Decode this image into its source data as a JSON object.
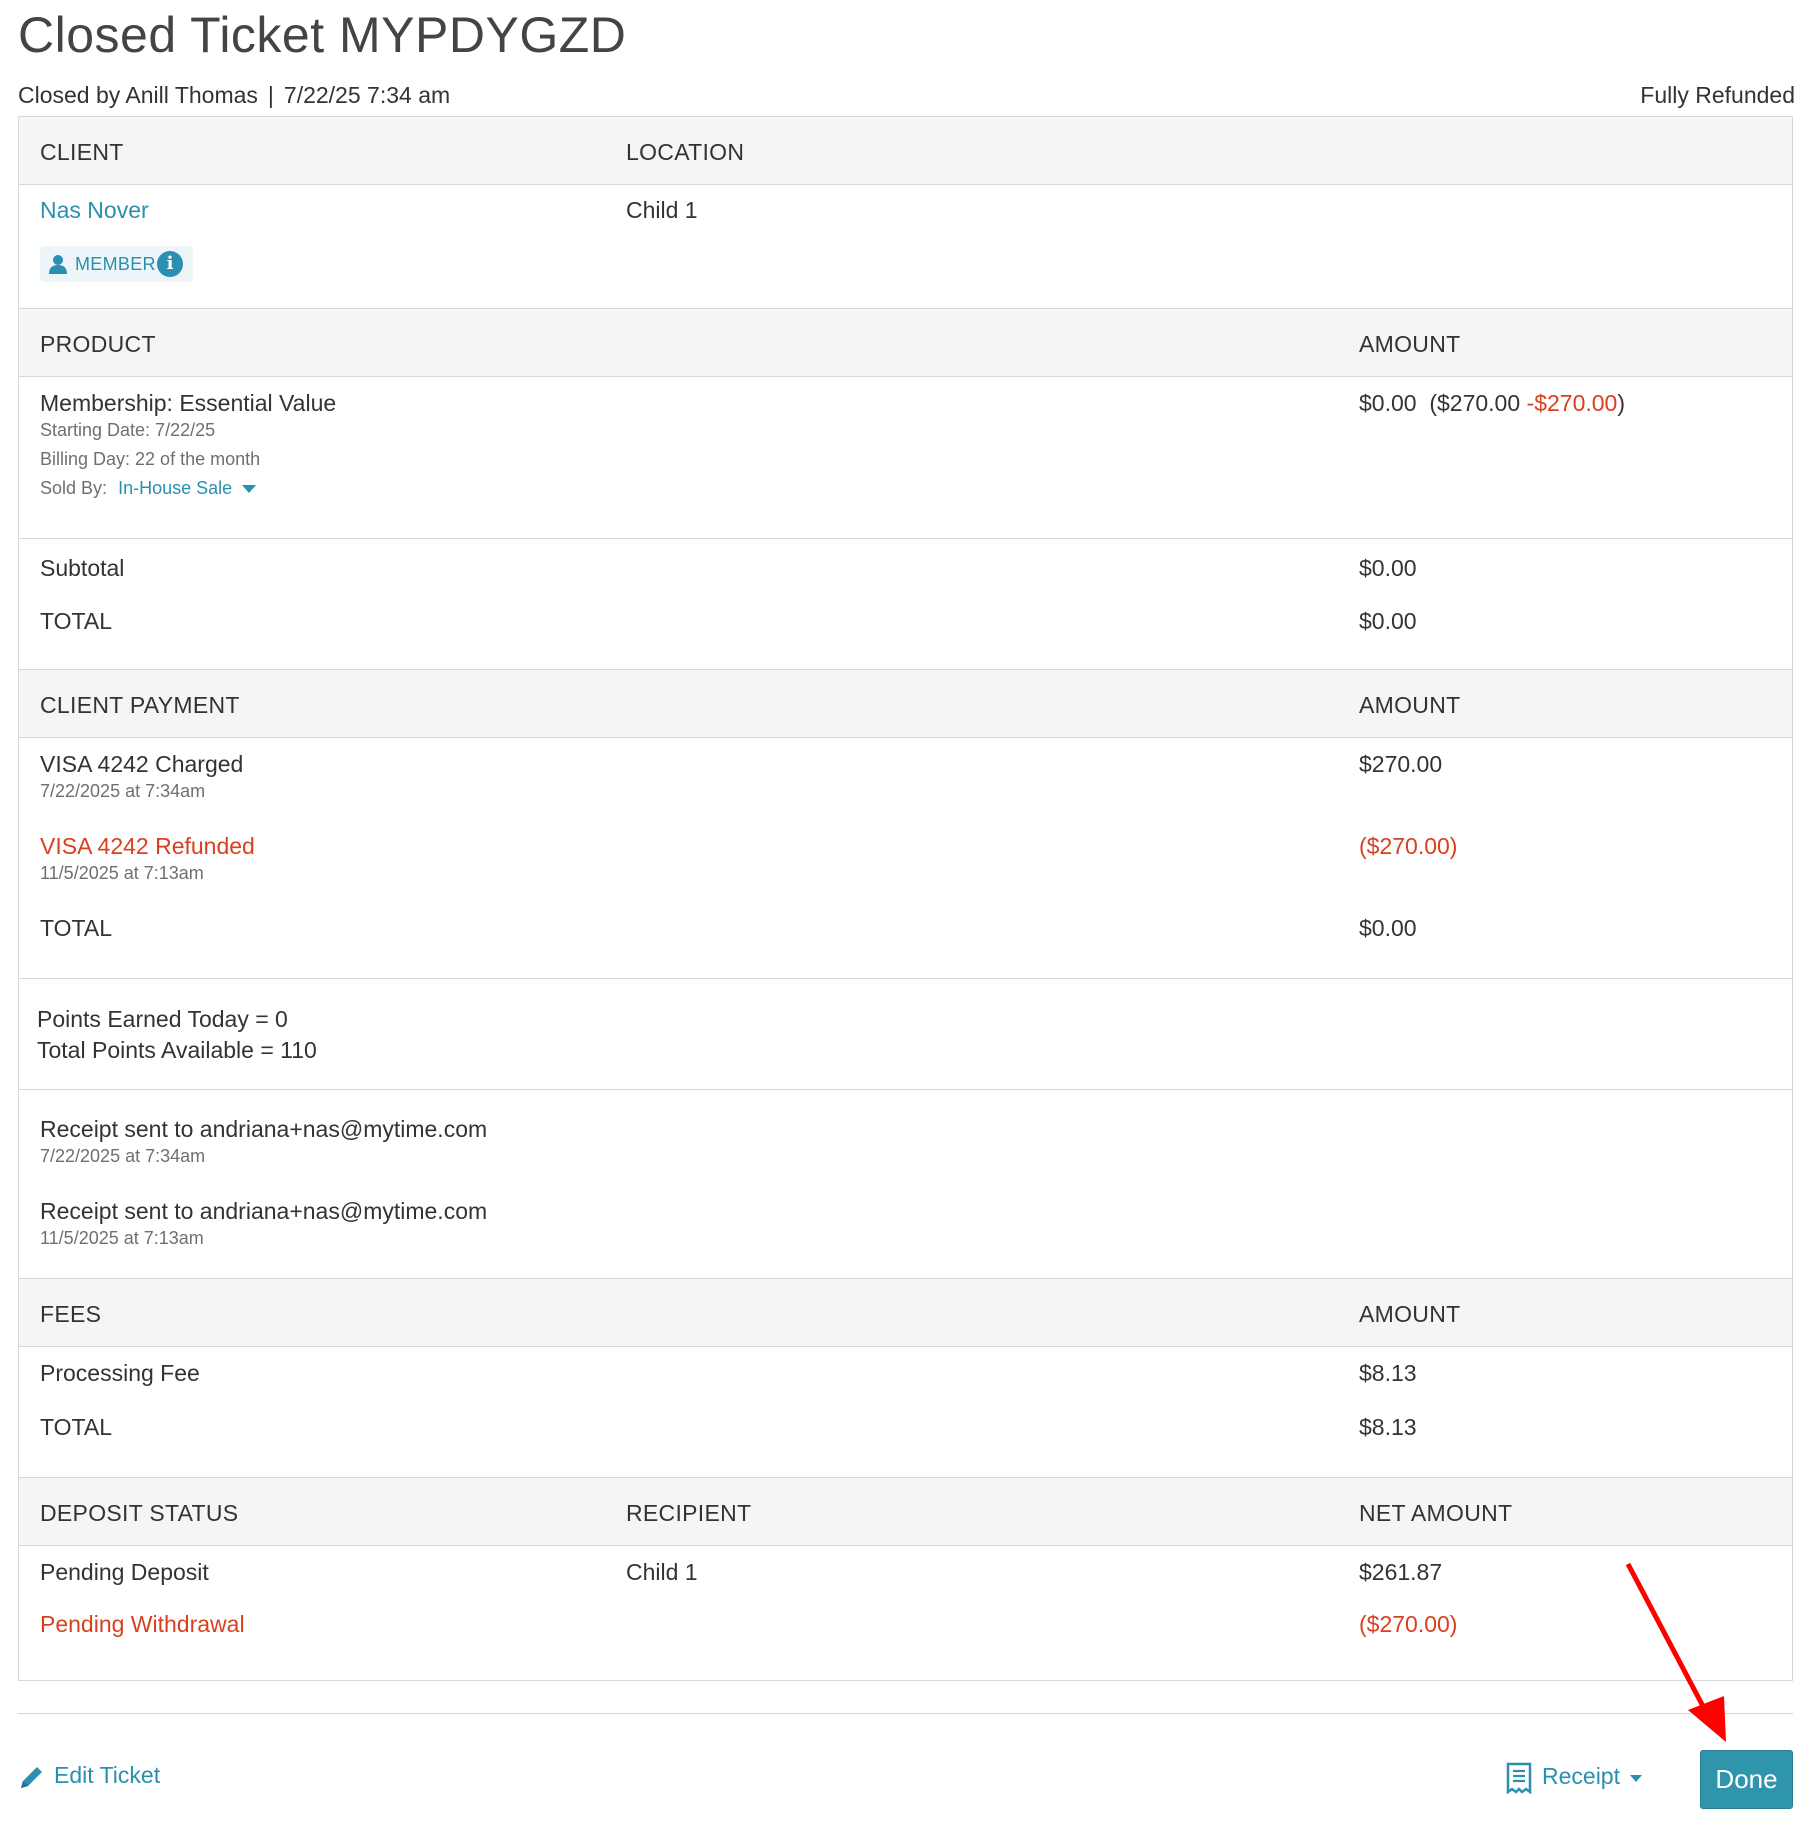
{
  "header": {
    "title": "Closed Ticket MYPDYGZD",
    "closed_by": "Closed by Anill Thomas",
    "separator": "|",
    "closed_at": "7/22/25 7:34 am",
    "status": "Fully Refunded"
  },
  "client_section": {
    "client_header": "CLIENT",
    "location_header": "LOCATION",
    "client_name": "Nas Nover",
    "member_badge": "MEMBER",
    "info_glyph": "i",
    "location": "Child 1"
  },
  "product_section": {
    "product_header": "PRODUCT",
    "amount_header": "AMOUNT",
    "product_name": "Membership: Essential Value",
    "starting_date": "Starting Date: 7/22/25",
    "billing_day": "Billing Day: 22 of the month",
    "sold_by_label": "Sold By:",
    "sold_by_value": "In-House Sale",
    "amount_main": "$0.00",
    "amount_open": "($270.00",
    "amount_discount": "-$270.00",
    "amount_close": ")"
  },
  "totals": {
    "subtotal_label": "Subtotal",
    "subtotal_value": "$0.00",
    "total_label": "TOTAL",
    "total_value": "$0.00"
  },
  "payment_section": {
    "header": "CLIENT PAYMENT",
    "amount_header": "AMOUNT",
    "payments": [
      {
        "label": "VISA 4242 Charged",
        "date": "7/22/2025 at 7:34am",
        "amount": "$270.00"
      },
      {
        "label": "VISA 4242 Refunded",
        "date": "11/5/2025 at 7:13am",
        "amount": "($270.00)"
      }
    ],
    "total_label": "TOTAL",
    "total_value": "$0.00"
  },
  "points": {
    "earned": "Points Earned Today = 0",
    "available": "Total Points Available = 110"
  },
  "receipts": [
    {
      "label": "Receipt sent to  andriana+nas@mytime.com",
      "date": "7/22/2025 at 7:34am"
    },
    {
      "label": "Receipt sent to  andriana+nas@mytime.com",
      "date": "11/5/2025 at 7:13am"
    }
  ],
  "fees_section": {
    "header": "FEES",
    "amount_header": "AMOUNT",
    "fee_label": "Processing Fee",
    "fee_value": "$8.13",
    "total_label": "TOTAL",
    "total_value": "$8.13"
  },
  "deposit_section": {
    "status_header": "DEPOSIT STATUS",
    "recipient_header": "RECIPIENT",
    "net_header": "NET AMOUNT",
    "rows": [
      {
        "status": "Pending Deposit",
        "recipient": "Child 1",
        "amount": "$261.87"
      },
      {
        "status": "Pending Withdrawal",
        "recipient": "",
        "amount": "($270.00)"
      }
    ]
  },
  "footer": {
    "edit_label": "Edit Ticket",
    "receipt_label": "Receipt",
    "done_label": "Done"
  },
  "colors": {
    "accent": "#2a8fb0",
    "negative": "#d9401f",
    "done_button": "#2e95ad",
    "annotation_arrow": "#ff0000"
  }
}
